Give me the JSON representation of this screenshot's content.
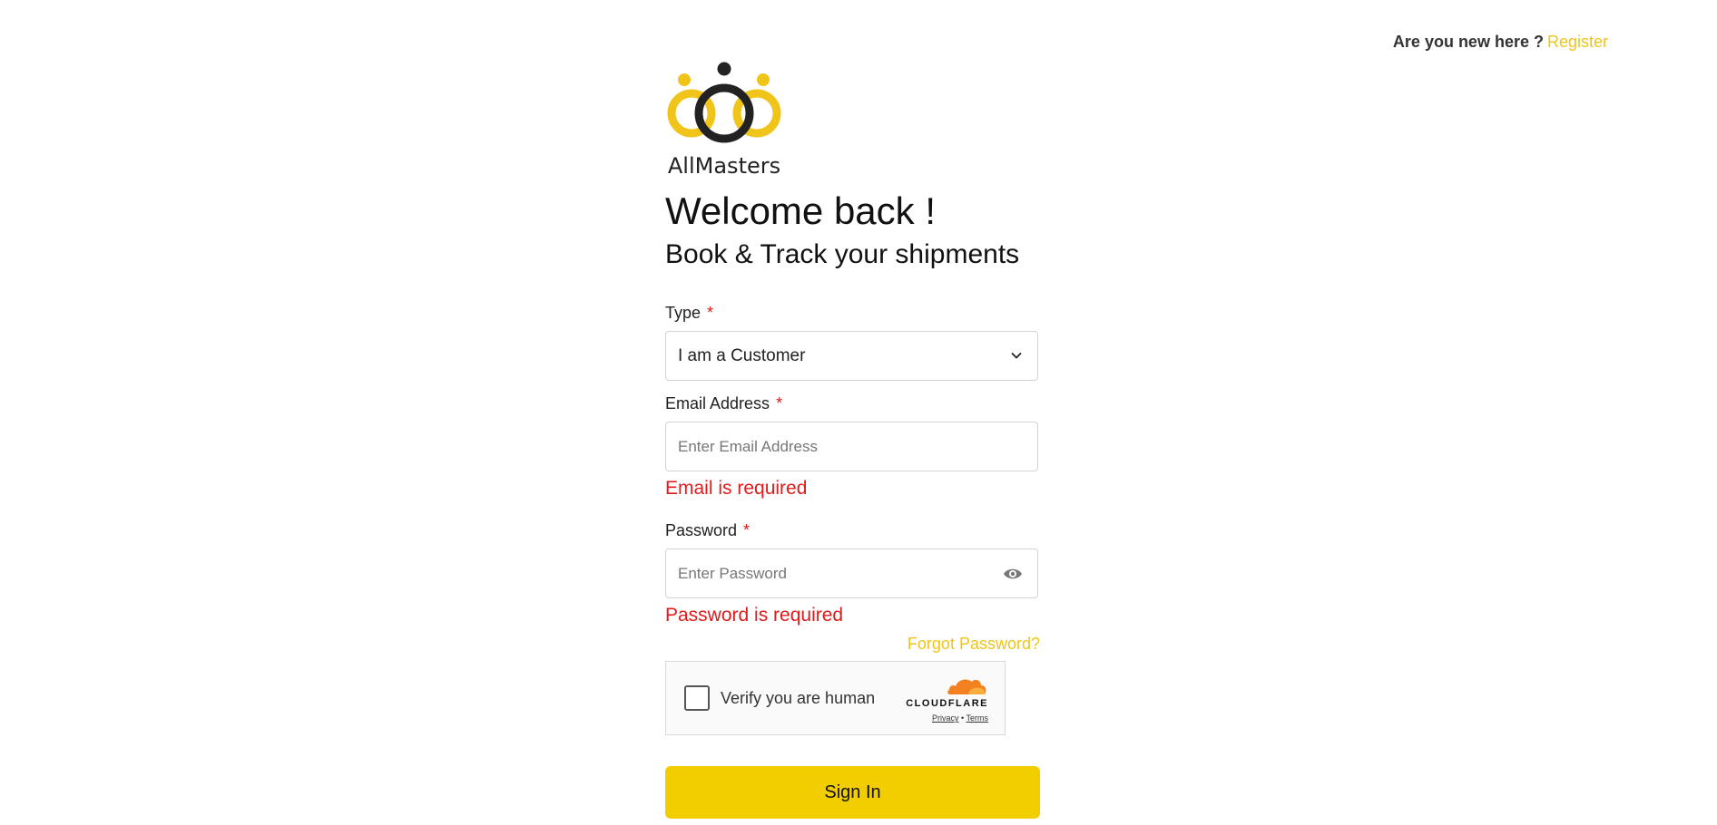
{
  "header": {
    "new_here_text": "Are you new here ?",
    "register_link": "Register"
  },
  "brand": {
    "name": "AllMasters",
    "colors": {
      "yellow": "#f0c419",
      "dark": "#222222"
    }
  },
  "hero": {
    "welcome": "Welcome back !",
    "subtitle": "Book & Track your shipments"
  },
  "form": {
    "type": {
      "label": "Type",
      "required_marker": "*",
      "selected": "I am a Customer"
    },
    "email": {
      "label": "Email Address",
      "required_marker": "*",
      "placeholder": "Enter Email Address",
      "error": "Email is required"
    },
    "password": {
      "label": "Password",
      "required_marker": "*",
      "placeholder": "Enter Password",
      "error": "Password is required"
    },
    "forgot_link": "Forgot Password?",
    "captcha": {
      "text": "Verify you are human",
      "provider": "CLOUDFLARE",
      "privacy": "Privacy",
      "separator": "•",
      "terms": "Terms"
    },
    "submit_label": "Sign In"
  },
  "colors": {
    "accent": "#f0c419",
    "button": "#f2ce00",
    "error": "#e01b1b"
  }
}
